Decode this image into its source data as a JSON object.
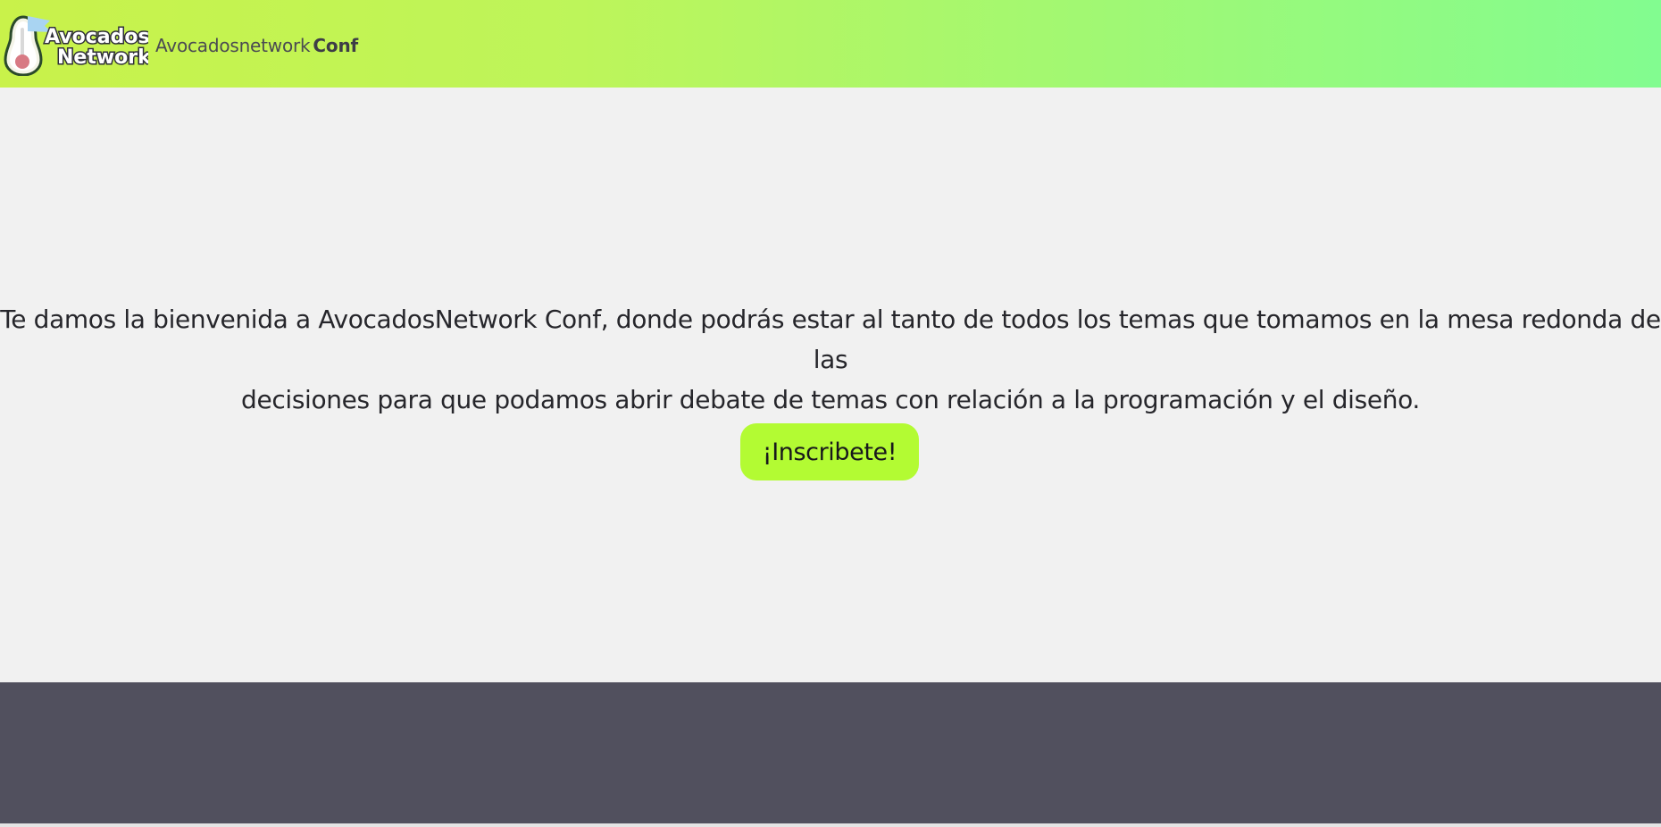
{
  "header": {
    "logo": {
      "icon": "avocado-icon",
      "wordmark_line1": "Avocados",
      "wordmark_line2": "Network"
    },
    "site_name": {
      "light": "Avocadosnetwork",
      "bold": "Conf"
    }
  },
  "main": {
    "welcome_line1": "Te damos la bienvenida a AvocadosNetwork Conf, donde podrás estar al tanto de todos los temas que tomamos en la mesa redonda de las",
    "welcome_line2": "decisiones para que podamos abrir debate de temas con relación a la programación y el diseño.",
    "cta_label": "¡Inscribete!"
  },
  "colors": {
    "header_gradient_start": "#c9f24a",
    "header_gradient_end": "#82fc90",
    "main_background": "#f1f1f1",
    "cta_background": "#b3fb33",
    "footer_background": "#51505e"
  }
}
